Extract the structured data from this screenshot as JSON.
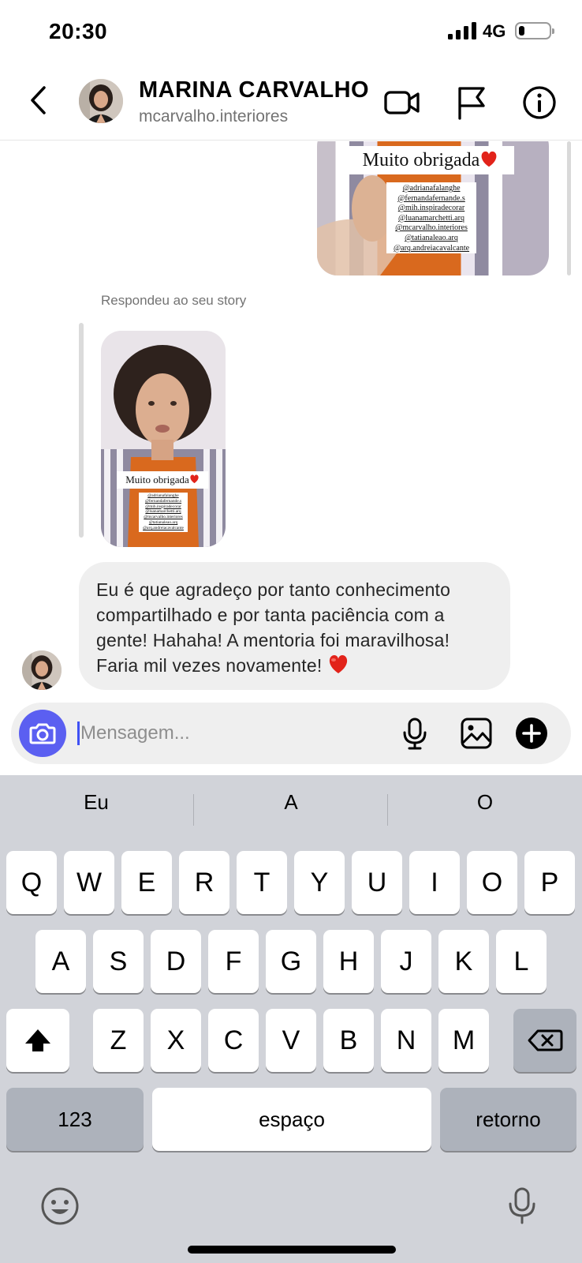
{
  "status_bar": {
    "time": "20:30",
    "network": "4G",
    "battery_level": 0.2
  },
  "header": {
    "name": "MARINA CARVALHO",
    "username": "mcarvalho.interiores",
    "icons": [
      "back-icon",
      "video-call-icon",
      "flag-icon",
      "info-icon"
    ]
  },
  "story": {
    "sticker_text": "Muito obrigada",
    "mentions": [
      "@adrianafalanghe",
      "@fernandafernande.s",
      "@mih.inspiradecorar",
      "@luanamarchetti.arq",
      "@mcarvalho.interiores",
      "@tatianaleao.arq",
      "@arq.andreiacavalcante"
    ]
  },
  "chat": {
    "reply_label": "Respondeu ao seu story",
    "message_lines": [
      "Eu é que agradeço por tanto conhecimento",
      "compartilhado e por tanta paciência com a",
      "gente! Hahaha! A mentoria foi maravilhosa!",
      "Faria mil vezes novamente!"
    ]
  },
  "composer": {
    "placeholder": "Mensagem...",
    "accent_color": "#5b5ff1"
  },
  "keyboard": {
    "suggestions": [
      "Eu",
      "A",
      "O"
    ],
    "row1": [
      "Q",
      "W",
      "E",
      "R",
      "T",
      "Y",
      "U",
      "I",
      "O",
      "P"
    ],
    "row2": [
      "A",
      "S",
      "D",
      "F",
      "G",
      "H",
      "J",
      "K",
      "L"
    ],
    "row3": [
      "Z",
      "X",
      "C",
      "V",
      "B",
      "N",
      "M"
    ],
    "numbers_key": "123",
    "space_key": "espaço",
    "return_key": "retorno"
  }
}
